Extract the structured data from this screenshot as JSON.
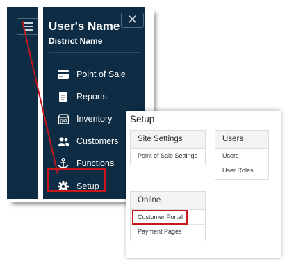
{
  "sidebar": {
    "user_name": "User's Name",
    "district_name": "District Name",
    "close_glyph": "✕",
    "items": [
      {
        "label": "Point of Sale",
        "icon": "card-icon"
      },
      {
        "label": "Reports",
        "icon": "document-icon"
      },
      {
        "label": "Inventory",
        "icon": "store-icon"
      },
      {
        "label": "Customers",
        "icon": "users-icon"
      },
      {
        "label": "Functions",
        "icon": "anchor-icon"
      },
      {
        "label": "Setup",
        "icon": "gear-icon"
      }
    ]
  },
  "setup_page": {
    "title": "Setup",
    "sections": [
      {
        "title": "Site Settings",
        "links": [
          "Point of Sale Settings"
        ]
      },
      {
        "title": "Users",
        "links": [
          "Users",
          "User Roles"
        ]
      },
      {
        "title": "Online",
        "links": [
          "Customer Portal",
          "Payment Pages"
        ]
      }
    ]
  },
  "colors": {
    "sidebar_bg": "#0e2c43",
    "highlight": "#c8161d"
  }
}
